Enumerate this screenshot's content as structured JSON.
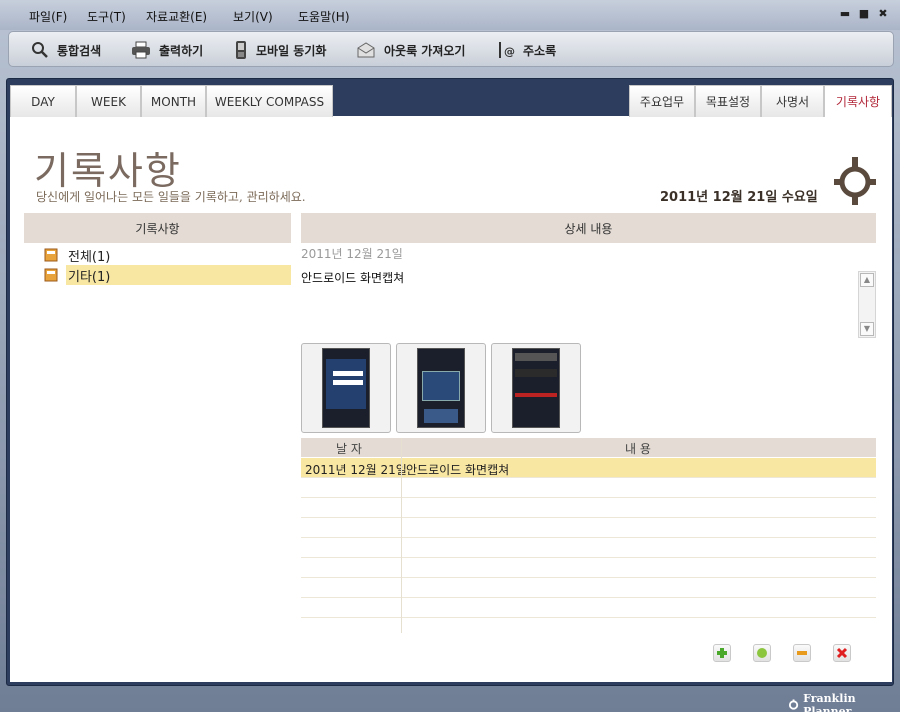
{
  "menu": {
    "items": [
      "파일(F)",
      "도구(T)",
      "자료교환(E)",
      "보기(V)",
      "도움말(H)"
    ]
  },
  "window_controls": {
    "minimize": "▬",
    "maximize": "■",
    "close": "✖"
  },
  "toolbar": {
    "search": "통합검색",
    "print": "출력하기",
    "mobile_sync": "모바일 동기화",
    "outlook_import": "아웃룩 가져오기",
    "address_book": "주소록"
  },
  "view_tabs": [
    "DAY",
    "WEEK",
    "MONTH",
    "WEEKLY COMPASS"
  ],
  "right_tabs": [
    "주요업무",
    "목표설정",
    "사명서",
    "기록사항"
  ],
  "active_tab": "기록사항",
  "header": {
    "title": "기록사항",
    "subtitle": "당신에게 일어나는 모든 일들을 기록하고, 관리하세요.",
    "date": "2011년 12월 21일 수요일"
  },
  "left_panel": {
    "heading": "기록사항",
    "items": [
      {
        "label": "전체(1)",
        "selected": false
      },
      {
        "label": "기타(1)",
        "selected": true
      }
    ]
  },
  "detail": {
    "heading": "상세 내용",
    "date": "2011년 12월 21일",
    "text": "안드로이드 화면캡쳐",
    "thumbnails": 3
  },
  "table": {
    "headers": [
      "날 자",
      "내 용"
    ],
    "rows": [
      {
        "date": "2011년 12월 21일",
        "content": "안드로이드 화면캡쳐"
      }
    ]
  },
  "brand": "Franklin Planner",
  "colors": {
    "accent": "#b2283a",
    "selection": "#f8e6a3",
    "panel_header": "#e3dbd4",
    "title": "#7a6a60"
  }
}
